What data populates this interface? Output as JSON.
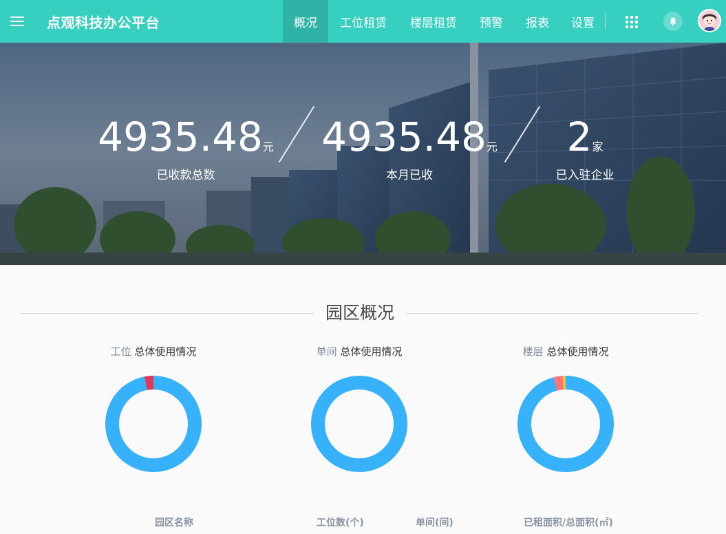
{
  "app": {
    "title": "点观科技办公平台"
  },
  "nav": {
    "items": [
      {
        "label": "概况",
        "active": true
      },
      {
        "label": "工位租赁",
        "active": false
      },
      {
        "label": "楼层租赁",
        "active": false
      },
      {
        "label": "预警",
        "active": false
      },
      {
        "label": "报表",
        "active": false
      },
      {
        "label": "设置",
        "active": false
      }
    ]
  },
  "hero": {
    "stats": [
      {
        "value": "4935.48",
        "unit": "元",
        "label": "已收款总数"
      },
      {
        "value": "4935.48",
        "unit": "元",
        "label": "本月已收"
      },
      {
        "value": "2",
        "unit": "家",
        "label": "已入驻企业"
      }
    ]
  },
  "overview": {
    "title": "园区概况",
    "charts": [
      {
        "prefix": "工位",
        "suffix": "总体使用情况",
        "segments": [
          {
            "fraction": 0.97,
            "color": "#36b1fa"
          },
          {
            "fraction": 0.03,
            "color": "#e0375a"
          }
        ]
      },
      {
        "prefix": "单间",
        "suffix": "总体使用情况",
        "segments": [
          {
            "fraction": 1.0,
            "color": "#36b1fa"
          }
        ]
      },
      {
        "prefix": "楼层",
        "suffix": "总体使用情况",
        "segments": [
          {
            "fraction": 0.96,
            "color": "#36b1fa"
          },
          {
            "fraction": 0.03,
            "color": "#ff7373"
          },
          {
            "fraction": 0.01,
            "color": "#f5c542"
          }
        ]
      }
    ],
    "table_headers": [
      "园区名称",
      "工位数(个)",
      "单间(间)",
      "已租面积/总面积(㎡)"
    ]
  },
  "colors": {
    "topbar": "#36cfc0",
    "donut_main": "#36b1fa"
  }
}
